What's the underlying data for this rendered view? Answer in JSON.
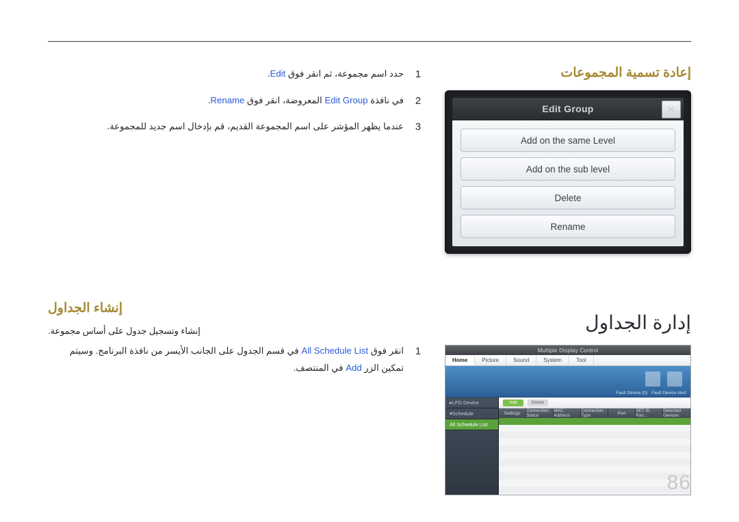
{
  "section1": {
    "title": "إعادة تسمية المجموعات",
    "steps": [
      {
        "n": "1",
        "pre": "حدد اسم مجموعة، ثم انقر فوق ",
        "hl": "Edit",
        "post": "."
      },
      {
        "n": "2",
        "pre": "في نافذة ",
        "hl": "Edit Group",
        "mid": " المعروضة، انقر فوق ",
        "hl2": "Rename",
        "post": "."
      },
      {
        "n": "3",
        "pre": "عندما يظهر المؤشر على اسم المجموعة القديم، قم بإدخال اسم جديد للمجموعة.",
        "hl": "",
        "post": ""
      }
    ]
  },
  "dialog": {
    "title": "Edit Group",
    "close_glyph": "✕",
    "buttons": [
      "Add on the same Level",
      "Add on the sub level",
      "Delete",
      "Rename"
    ]
  },
  "section2": {
    "major": "إدارة الجداول",
    "title": "إنشاء الجداول",
    "desc": "إنشاء وتسجيل جدول على أساس مجموعة.",
    "step": {
      "n": "1",
      "pre": "انقر فوق ",
      "hl1": "All Schedule List",
      "mid": " في قسم الجدول على الجانب الأيسر من نافذة البرنامج. وسيتم تمكين الزر ",
      "hl2": "Add",
      "post": " في المنتصف."
    }
  },
  "mdc": {
    "title": "Multiple Display Control",
    "tabs": [
      "Home",
      "Picture",
      "Sound",
      "System",
      "Tool"
    ],
    "icons": [
      "Fault Device (0)",
      "Fault Device Alert"
    ],
    "side": {
      "lfd": "LFD Device",
      "sched": "Schedule",
      "sel": "All Schedule List"
    },
    "btns": {
      "add": "Add",
      "del": "Delete"
    },
    "headers": [
      "Settings",
      "Connection Status",
      "MAC Address",
      "Connection Type",
      "Port",
      "SET ID Ran...",
      "Detected Devices"
    ]
  },
  "page_number": "86"
}
